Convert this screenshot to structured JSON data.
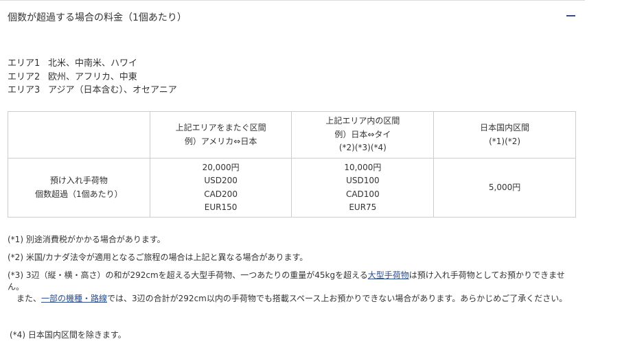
{
  "header": {
    "title": "個数が超過する場合の料金（1個あたり）",
    "collapse_symbol": "—"
  },
  "areas": [
    {
      "label": "エリア1",
      "regions": "北米、中南米、ハワイ"
    },
    {
      "label": "エリア2",
      "regions": "欧州、アフリカ、中東"
    },
    {
      "label": "エリア3",
      "regions": "アジア（日本含む）、オセアニア"
    }
  ],
  "table": {
    "headers": [
      {
        "lines": [
          "上記エリアをまたぐ区間",
          "例）アメリカ⇔日本"
        ]
      },
      {
        "lines": [
          "上記エリア内の区間",
          "例）日本⇔タイ",
          "(*2)(*3)(*4)"
        ]
      },
      {
        "lines": [
          "日本国内区間",
          "(*1)(*2)"
        ]
      }
    ],
    "row_header": [
      "預け入れ手荷物",
      "個数超過（1個あたり）"
    ],
    "cells": [
      [
        "20,000円",
        "USD200",
        "CAD200",
        "EUR150"
      ],
      [
        "10,000円",
        "USD100",
        "CAD100",
        "EUR75"
      ],
      [
        "5,000円"
      ]
    ]
  },
  "notes": {
    "n1": "(*1) 別途消費税がかかる場合があります。",
    "n2": "(*2) 米国/カナダ法令が適用となるご旅程の場合は上記と異なる場合があります。",
    "n3_prefix": "(*3) 3辺（縦・横・高さ）の和が292cmを超える大型手荷物、一つあたりの重量が45kgを超える",
    "n3_link": "大型手荷物",
    "n3_suffix": "は預け入れ手荷物としてお預かりできません。",
    "n3b_prefix": "また、",
    "n3b_link": "一部の機種・路線",
    "n3b_suffix": "では、3辺の合計が292cm以内の手荷物でも搭載スペース上お預かりできない場合があります。あらかじめご了承ください。",
    "n4": "(*4) 日本国内区間を除きます。"
  },
  "colors": {
    "accent": "#2a4d8f",
    "border": "#cccccc",
    "text": "#333333"
  }
}
